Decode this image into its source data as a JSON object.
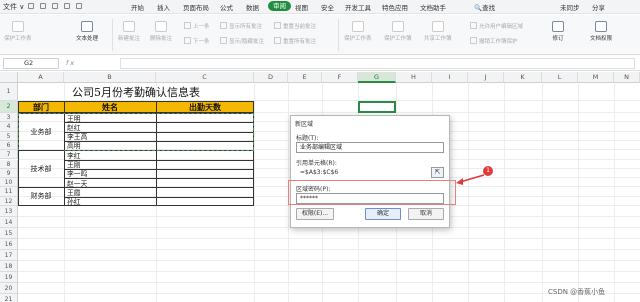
{
  "menubar": {
    "file": "文件 ∨",
    "tabs": [
      "开始",
      "插入",
      "页面布局",
      "公式",
      "数据",
      "审阅",
      "视图",
      "安全",
      "开发工具",
      "特色应用",
      "文档助手"
    ],
    "active_tab": "审阅",
    "search": "查找",
    "unsync": "未同步",
    "share": "分享"
  },
  "ribbon": {
    "buttons": [
      "保护工作表",
      "文本处理",
      "翻译",
      "新建批注",
      "删除批注",
      "修订",
      "文档权限"
    ],
    "small": [
      "上一条",
      "下一条",
      "显示所有批注",
      "显示/隐藏批注",
      "显示墨迹",
      "重置当前批注",
      "重置所有批注",
      "保护工作表",
      "保护工作簿",
      "共享工作簿",
      "允许用户编辑区域",
      "撤销工作簿保护"
    ]
  },
  "formula": {
    "namebox": "G2",
    "fx": "fx"
  },
  "columns": [
    "A",
    "B",
    "C",
    "D",
    "E",
    "F",
    "G",
    "H",
    "I",
    "J",
    "K",
    "L",
    "M",
    "N"
  ],
  "rows": [
    "1",
    "2",
    "3",
    "4",
    "5",
    "6",
    "7",
    "8",
    "9",
    "10",
    "11",
    "12",
    "13",
    "14",
    "15",
    "16",
    "17",
    "18",
    "19",
    "20",
    "21",
    "22"
  ],
  "table": {
    "title": "公司5月份考勤确认信息表",
    "headers": [
      "部门",
      "姓名",
      "出勤天数"
    ],
    "departments": [
      "业务部",
      "技术部",
      "财务部"
    ],
    "names": [
      "王明",
      "赵红",
      "李王高",
      "高明",
      "李红",
      "王刚",
      "李一鸣",
      "赵一天",
      "王霞",
      "孙红"
    ]
  },
  "dialog": {
    "title": "新区域",
    "title_label": "标题(T):",
    "title_value": "业务部编辑区域",
    "ref_label": "引用单元格(R):",
    "ref_value": "=$A$3:$C$6",
    "pwd_label": "区域密码(P):",
    "pwd_value": "******",
    "permissions_btn": "权限(E)...",
    "ok_btn": "确定",
    "cancel_btn": "取消"
  },
  "annotation": {
    "badge": "1",
    "color": "#e03a3a"
  },
  "watermark": "CSDN @香蕉小鱼"
}
